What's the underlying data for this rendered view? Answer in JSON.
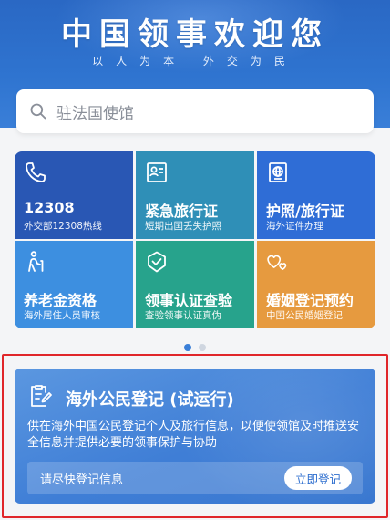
{
  "hero": {
    "title": "中国领事欢迎您",
    "subtitle": "以人为本 外交为民"
  },
  "search": {
    "placeholder": "驻法国使馆",
    "icon": "search-icon"
  },
  "tiles": [
    {
      "title": "12308",
      "subtitle": "外交部12308热线",
      "icon": "phone-icon",
      "color": "#2957b4"
    },
    {
      "title": "紧急旅行证",
      "subtitle": "短期出国丢失护照",
      "icon": "id-card-icon",
      "color": "#2f8fb7"
    },
    {
      "title": "护照/旅行证",
      "subtitle": "海外证件办理",
      "icon": "passport-icon",
      "color": "#2f6dd6"
    },
    {
      "title": "养老金资格",
      "subtitle": "海外居住人员审核",
      "icon": "elderly-person-icon",
      "color": "#3d8fe0"
    },
    {
      "title": "领事认证查验",
      "subtitle": "查验领事认证真伪",
      "icon": "shield-check-icon",
      "color": "#27a38c"
    },
    {
      "title": "婚姻登记预约",
      "subtitle": "中国公民婚姻登记",
      "icon": "hearts-icon",
      "color": "#e69a3f"
    }
  ],
  "pager": {
    "count": 2,
    "active": 0
  },
  "registration": {
    "title": "海外公民登记 (试运行)",
    "description": "供在海外中国公民登记个人及旅行信息，以便使领馆及时推送安全信息并提供必要的领事保护与协助",
    "prompt": "请尽快登记信息",
    "button": "立即登记",
    "icon": "register-form-icon"
  },
  "colors": {
    "brand": "#2f74d0",
    "highlight": "#e0262a"
  }
}
